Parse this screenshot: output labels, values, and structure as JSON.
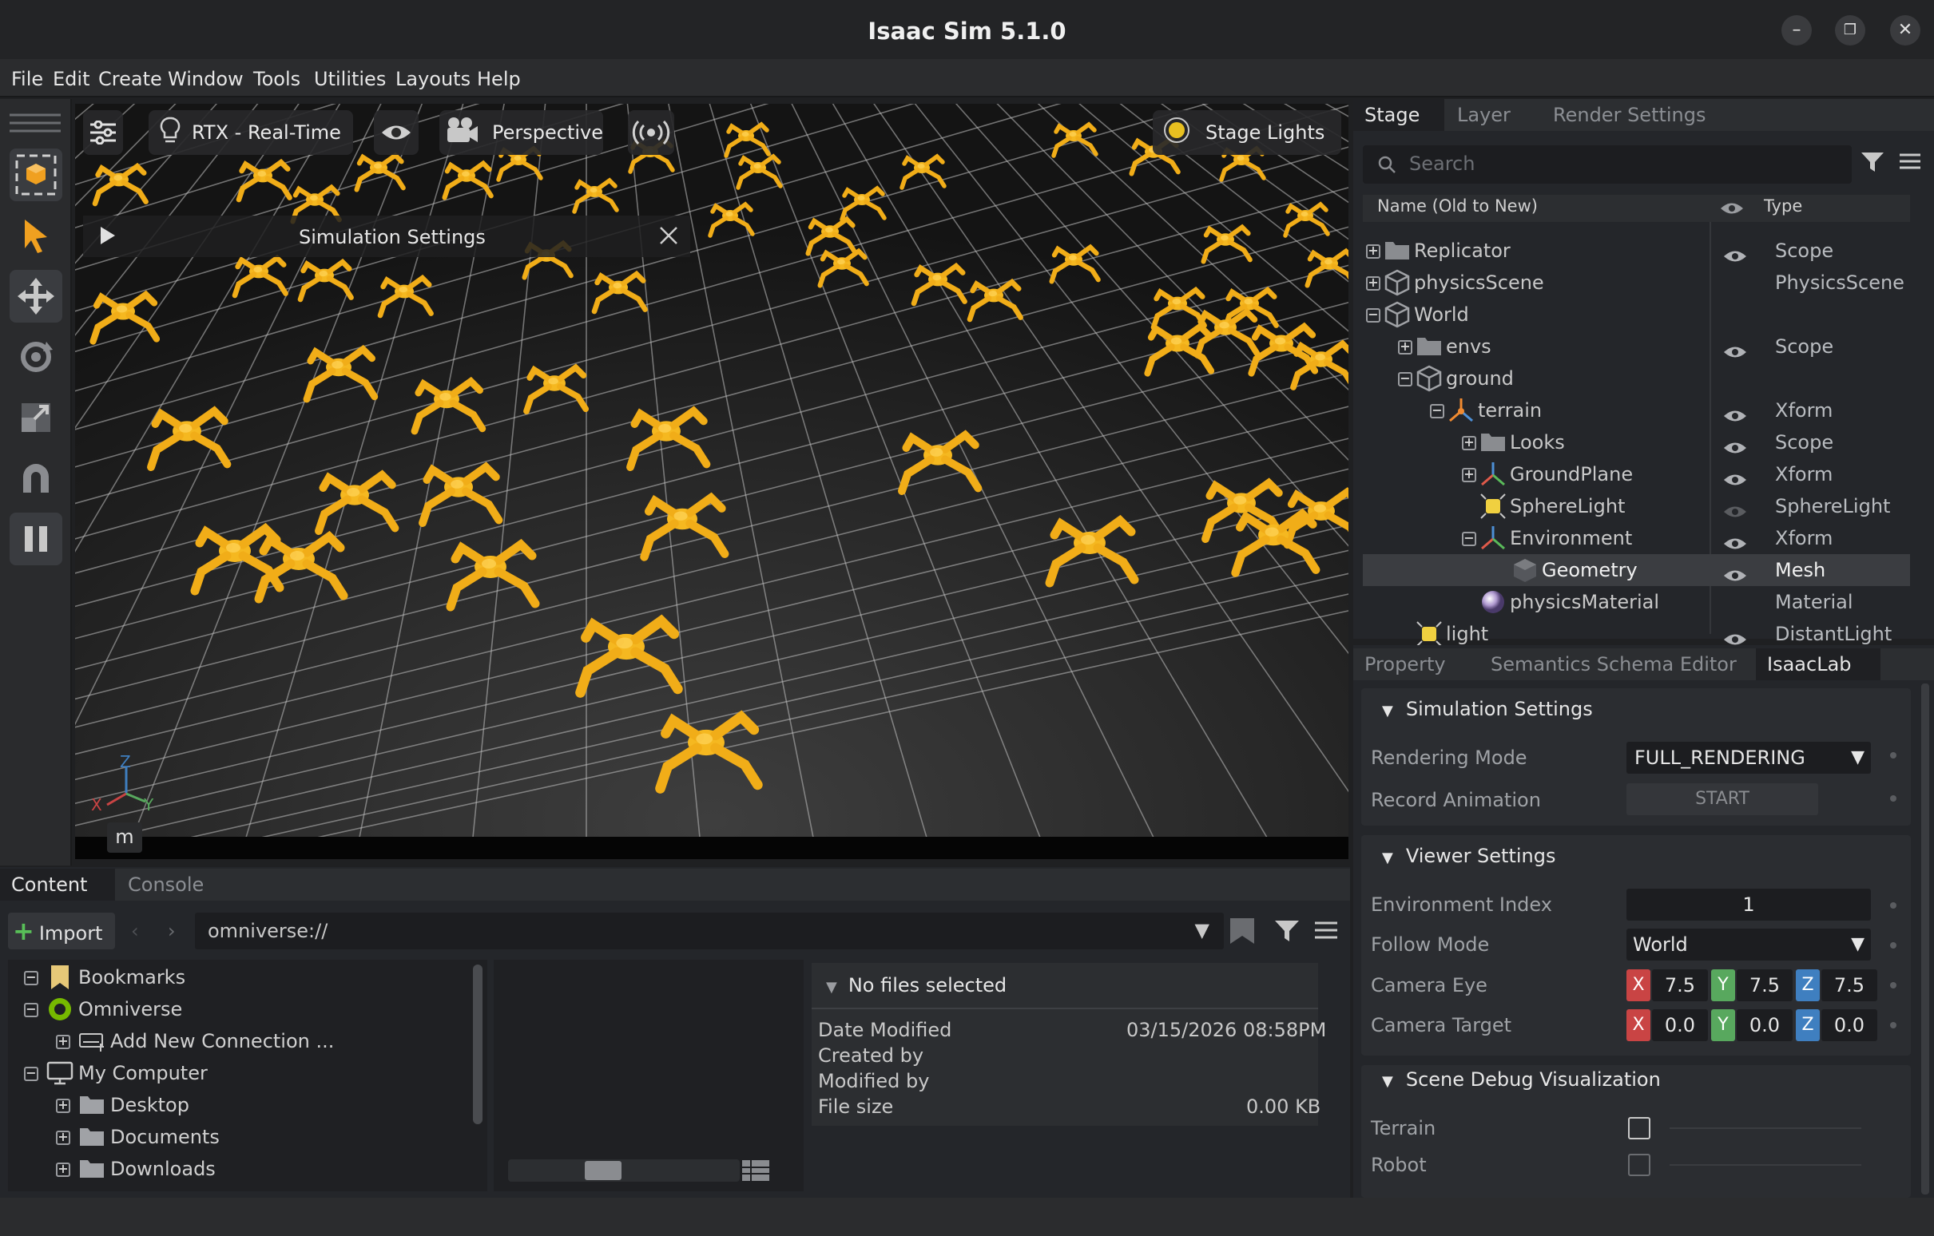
{
  "window": {
    "title": "Isaac Sim 5.1.0"
  },
  "menubar": {
    "items": [
      "File",
      "Edit",
      "Create",
      "Window",
      "Tools",
      "Utilities",
      "Layouts",
      "Help"
    ]
  },
  "viewport": {
    "renderer_label": "RTX - Real-Time",
    "camera_label": "Perspective",
    "lights_label": "Stage Lights",
    "overlay_title": "Simulation Settings",
    "units_label": "m",
    "axis_labels": {
      "x": "X",
      "y": "Y",
      "z": "Z"
    }
  },
  "stage": {
    "tabs": [
      "Stage",
      "Layer",
      "Render Settings"
    ],
    "search_placeholder": "Search",
    "col_name": "Name (Old to New)",
    "col_type": "Type",
    "rows": [
      {
        "name": "Replicator",
        "type": "Scope",
        "expander": "+"
      },
      {
        "name": "physicsScene",
        "type": "PhysicsScene",
        "expander": "+"
      },
      {
        "name": "World",
        "type": "",
        "expander": "−"
      },
      {
        "name": "envs",
        "type": "Scope",
        "expander": "+"
      },
      {
        "name": "ground",
        "type": "",
        "expander": "−"
      },
      {
        "name": "terrain",
        "type": "Xform",
        "expander": "−"
      },
      {
        "name": "Looks",
        "type": "Scope",
        "expander": "+"
      },
      {
        "name": "GroundPlane",
        "type": "Xform",
        "expander": "+"
      },
      {
        "name": "SphereLight",
        "type": "SphereLight",
        "expander": ""
      },
      {
        "name": "Environment",
        "type": "Xform",
        "expander": "−"
      },
      {
        "name": "Geometry",
        "type": "Mesh",
        "expander": ""
      },
      {
        "name": "physicsMaterial",
        "type": "Material",
        "expander": ""
      },
      {
        "name": "light",
        "type": "DistantLight",
        "expander": ""
      }
    ]
  },
  "property": {
    "tabs": [
      "Property",
      "Semantics Schema Editor",
      "IsaacLab"
    ],
    "simulation": {
      "title": "Simulation Settings",
      "rendering_mode_label": "Rendering Mode",
      "rendering_mode_value": "FULL_RENDERING",
      "record_label": "Record Animation",
      "record_button": "START"
    },
    "viewer": {
      "title": "Viewer Settings",
      "env_index_label": "Environment Index",
      "env_index_value": "1",
      "follow_mode_label": "Follow Mode",
      "follow_mode_value": "World",
      "camera_eye_label": "Camera Eye",
      "camera_eye": [
        "7.5",
        "7.5",
        "7.5"
      ],
      "camera_target_label": "Camera Target",
      "camera_target": [
        "0.0",
        "0.0",
        "0.0"
      ],
      "axis_x": "X",
      "axis_y": "Y",
      "axis_z": "Z"
    },
    "debug": {
      "title": "Scene Debug Visualization",
      "terrain_label": "Terrain",
      "robot_label": "Robot"
    }
  },
  "content": {
    "tabs": [
      "Content",
      "Console"
    ],
    "import_label": "Import",
    "path": "omniverse://",
    "tree": [
      {
        "label": "Bookmarks",
        "indent": 0,
        "expander": "−",
        "icon": "bookmark-icon"
      },
      {
        "label": "Omniverse",
        "indent": 0,
        "expander": "−",
        "icon": "omniverse-icon"
      },
      {
        "label": "Add New Connection ...",
        "indent": 1,
        "expander": "+",
        "icon": "connection-icon"
      },
      {
        "label": "My Computer",
        "indent": 0,
        "expander": "−",
        "icon": "computer-icon"
      },
      {
        "label": "Desktop",
        "indent": 1,
        "expander": "+",
        "icon": "folder-icon"
      },
      {
        "label": "Documents",
        "indent": 1,
        "expander": "+",
        "icon": "folder-icon"
      },
      {
        "label": "Downloads",
        "indent": 1,
        "expander": "+",
        "icon": "folder-icon"
      }
    ],
    "details": {
      "title": "No files selected",
      "date_modified_label": "Date Modified",
      "date_modified_value": "03/15/2026 08:58PM",
      "created_by_label": "Created by",
      "modified_by_label": "Modified by",
      "file_size_label": "File size",
      "file_size_value": "0.00 KB"
    }
  },
  "colors": {
    "accent_orange": "#f0a020",
    "robot_yellow": "#f5b820",
    "axis_x": "#c94444",
    "axis_y": "#58a85e",
    "axis_z": "#3f7fc0"
  }
}
